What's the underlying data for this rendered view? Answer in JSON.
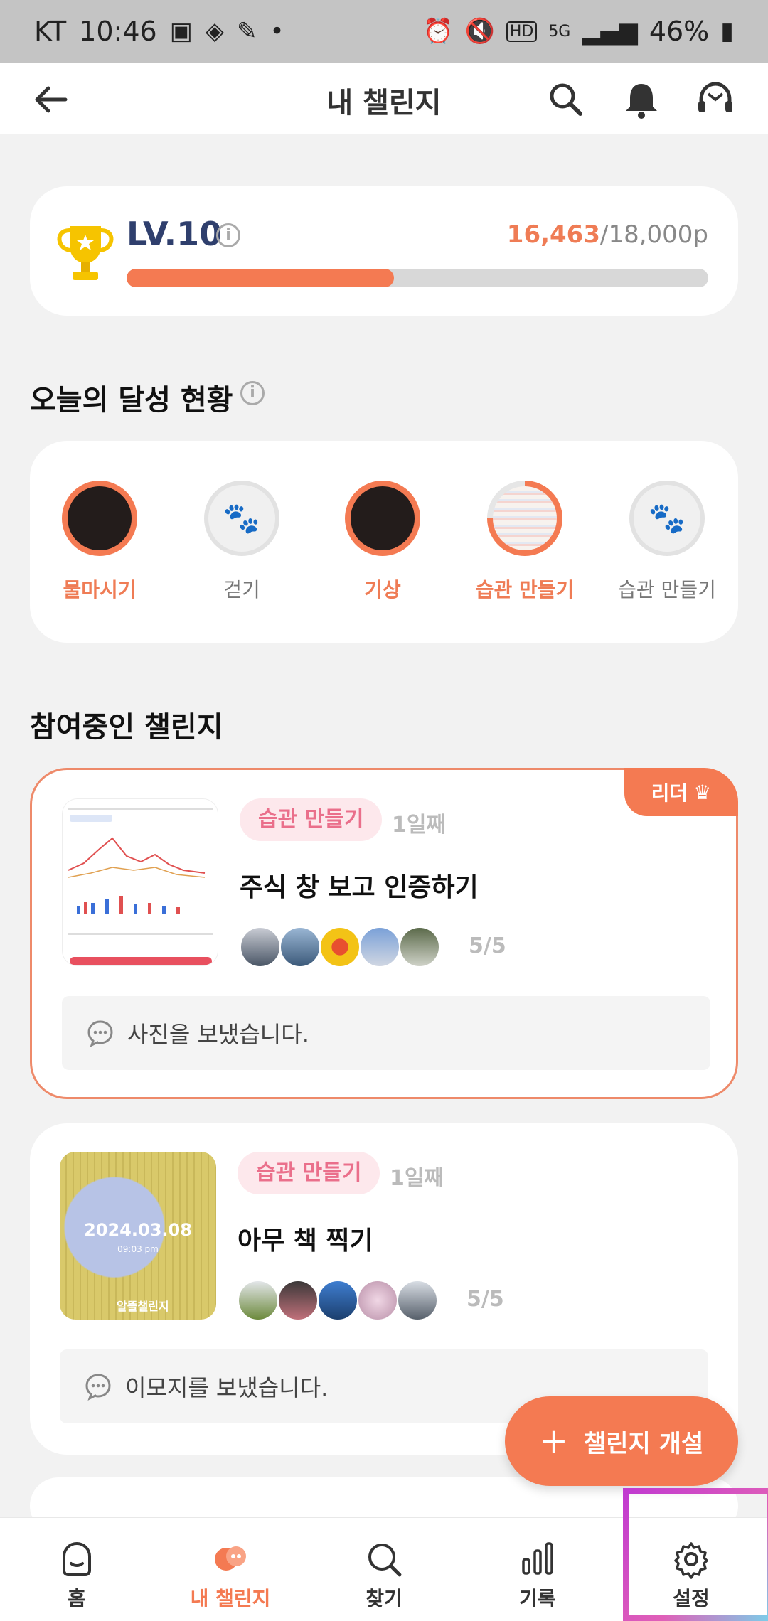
{
  "status_bar": {
    "carrier": "KT",
    "time": "10:46",
    "battery": "46%",
    "network": "5G",
    "hd": "HD"
  },
  "header": {
    "title": "내 챌린지"
  },
  "level": {
    "label": "LV.10",
    "current_points": "16,463",
    "max_points": "/18,000p",
    "progress_fraction": 0.46
  },
  "today": {
    "title": "오늘의 달성 현황",
    "habits": [
      {
        "label": "물마시기",
        "state": "done"
      },
      {
        "label": "걷기",
        "state": "empty"
      },
      {
        "label": "기상",
        "state": "done"
      },
      {
        "label": "습관 만들기",
        "state": "partial"
      },
      {
        "label": "습관 만들기",
        "state": "empty"
      }
    ]
  },
  "participating": {
    "title": "참여중인 챌린지",
    "challenges": [
      {
        "badge": "리더",
        "tag": "습관 만들기",
        "day": "1일째",
        "title": "주식 창 보고 인증하기",
        "count": "5/5",
        "message": "사진을 보냈습니다."
      },
      {
        "tag": "습관 만들기",
        "day": "1일째",
        "title": "아무 책 찍기",
        "count": "5/5",
        "message": "이모지를 보냈습니다.",
        "thumb_date": "2024.03.08",
        "thumb_time": "09:03 pm",
        "thumb_brand": "알뜰챌린지"
      }
    ]
  },
  "fab": {
    "label": "챌린지 개설"
  },
  "nav": {
    "items": [
      {
        "label": "홈"
      },
      {
        "label": "내 챌린지"
      },
      {
        "label": "찾기"
      },
      {
        "label": "기록"
      },
      {
        "label": "설정"
      }
    ]
  },
  "colors": {
    "accent": "#f47a52",
    "tag_bg": "#fde8ec",
    "tag_text": "#ea6f8b"
  }
}
